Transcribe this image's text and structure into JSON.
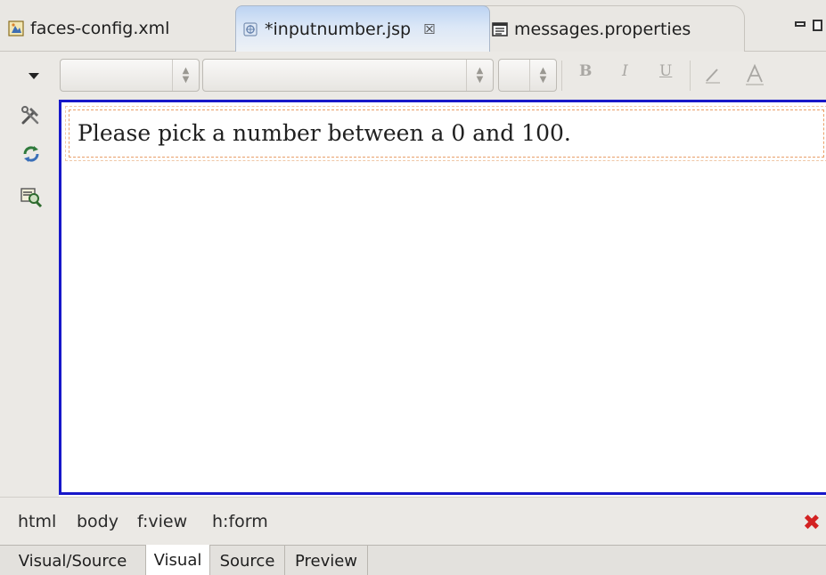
{
  "editor_tabs": [
    {
      "label": "faces-config.xml",
      "icon": "xml-config-icon",
      "active": false,
      "dirty": false
    },
    {
      "label": "*inputnumber.jsp",
      "icon": "jsp-file-icon",
      "active": true,
      "dirty": true,
      "close_glyph": "☒"
    },
    {
      "label": "messages.properties",
      "icon": "properties-file-icon",
      "active": false,
      "dirty": false
    }
  ],
  "window_controls": {
    "minimize": "minimize-icon",
    "maximize": "maximize-icon"
  },
  "toolbar": {
    "dropdown_icon": "dropdown-arrow-icon",
    "style_combo_value": "",
    "font_combo_value": "",
    "size_combo_value": "",
    "bold_label": "B",
    "italic_label": "I",
    "underline_label": "U",
    "disabled_color": "#a9a7a3"
  },
  "side_tools": [
    {
      "icon": "preferences-tools-icon"
    },
    {
      "icon": "refresh-icon"
    },
    {
      "icon": "page-design-options-icon"
    }
  ],
  "canvas": {
    "border_color": "#1717c9",
    "form_text": "Please pick a number between a 0 and 100."
  },
  "breadcrumb": {
    "items": [
      "html",
      "body",
      "f:view",
      "h:form"
    ],
    "close_icon": "close-red-icon",
    "close_color": "#d32222"
  },
  "page_tabs": [
    {
      "label": "Visual/Source",
      "active": false
    },
    {
      "label": "Visual",
      "active": true
    },
    {
      "label": "Source",
      "active": false
    },
    {
      "label": "Preview",
      "active": false
    }
  ]
}
